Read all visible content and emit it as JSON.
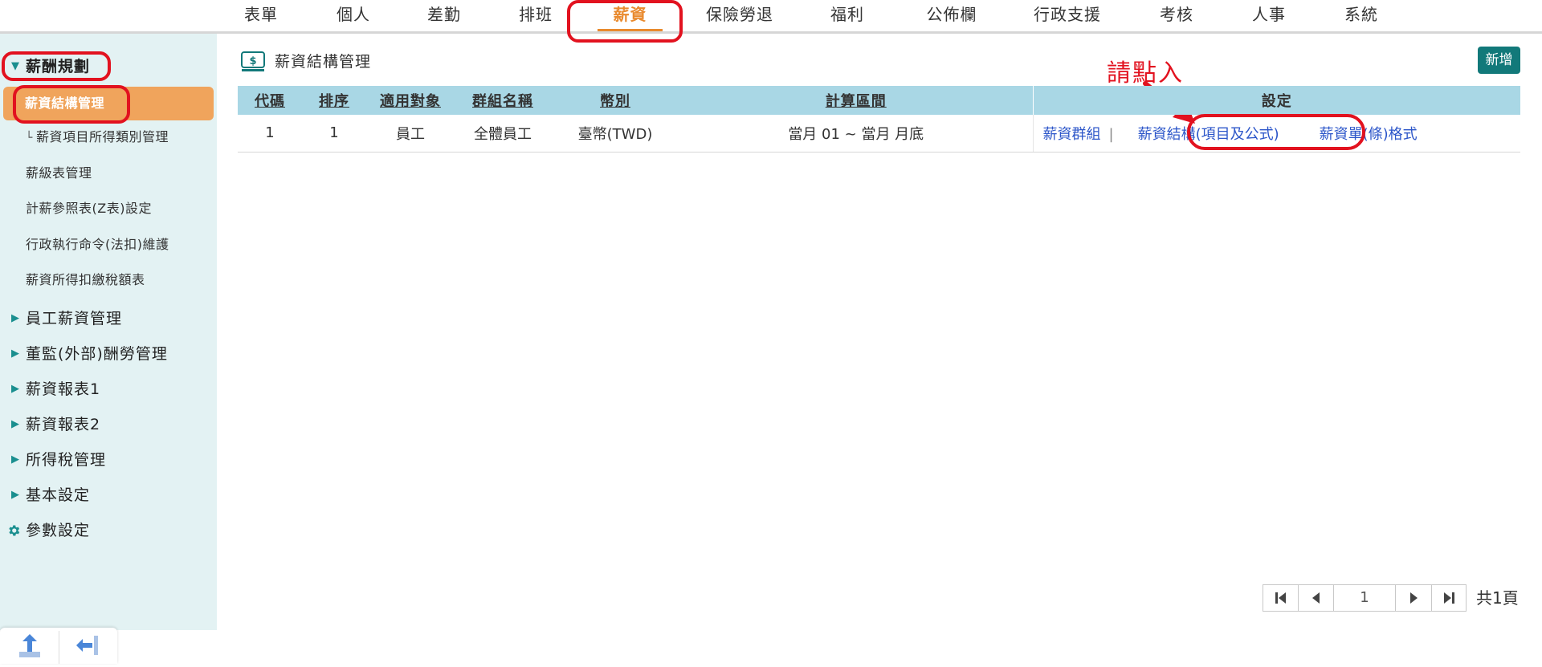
{
  "topnav": {
    "tabs": [
      {
        "label": "表單"
      },
      {
        "label": "個人"
      },
      {
        "label": "差勤"
      },
      {
        "label": "排班"
      },
      {
        "label": "薪資"
      },
      {
        "label": "保險勞退"
      },
      {
        "label": "福利"
      },
      {
        "label": "公佈欄"
      },
      {
        "label": "行政支援"
      },
      {
        "label": "考核"
      },
      {
        "label": "人事"
      },
      {
        "label": "系統"
      }
    ]
  },
  "sidebar": {
    "group_open": "薪酬規劃",
    "items": [
      {
        "label": "薪資結構管理"
      },
      {
        "label": "薪資項目所得類別管理"
      },
      {
        "label": "薪級表管理"
      },
      {
        "label": "計薪參照表(Z表)設定"
      },
      {
        "label": "行政執行命令(法扣)維護"
      },
      {
        "label": "薪資所得扣繳稅額表"
      }
    ],
    "sub_marker": "└",
    "groups": [
      {
        "label": "員工薪資管理"
      },
      {
        "label": "董監(外部)酬勞管理"
      },
      {
        "label": "薪資報表1"
      },
      {
        "label": "薪資報表2"
      },
      {
        "label": "所得稅管理"
      },
      {
        "label": "基本設定"
      },
      {
        "label": "參數設定"
      }
    ]
  },
  "main": {
    "page_title": "薪資結構管理",
    "add_label": "新增",
    "annotation": "請點入",
    "table": {
      "headers": [
        "代碼",
        "排序",
        "適用對象",
        "群組名稱",
        "幣別",
        "計算區間",
        "設定"
      ],
      "rows": [
        {
          "code": "1",
          "order": "1",
          "target": "員工",
          "group": "全體員工",
          "currency": "臺幣(TWD)",
          "period": "當月 01 ~ 當月 月底",
          "link_group": "薪資群組",
          "separator": "|",
          "link_structure": "薪資結構(項目及公式)",
          "link_slip": "薪資單(條)格式"
        }
      ]
    },
    "pager": {
      "page": "1",
      "total": "共1頁"
    }
  },
  "colors": {
    "accent_orange": "#e98a2e",
    "active_item_bg": "#f0a45c",
    "sidebar_bg": "#e3f2f3",
    "header_bg": "#a9d7e5",
    "add_button": "#12797a",
    "link": "#2c56c9",
    "annotation_red": "#e2121f"
  },
  "icons": [
    "money-icon",
    "caret-right-icon",
    "caret-down-icon",
    "gear-icon",
    "first-page-icon",
    "prev-page-icon",
    "next-page-icon",
    "last-page-icon",
    "upload-icon",
    "collapse-sidebar-icon",
    "annotation-arrow-icon"
  ]
}
